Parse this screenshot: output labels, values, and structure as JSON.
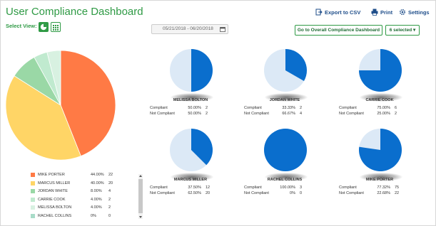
{
  "header": {
    "title": "User Compliance Dashboard",
    "export_label": "Export to CSV",
    "print_label": "Print",
    "settings_label": "Settings"
  },
  "toolbar": {
    "select_view_label": "Select View:",
    "date_range": "05/21/2018 - 06/20/2018",
    "overall_button": "Go to Overall Compliance Dashboard",
    "selected_dropdown": "6 selected ▾"
  },
  "colors": {
    "accent_green": "#2f9a45",
    "compliant_blue": "#0a6ecd",
    "not_compliant_light": "#dce9f6"
  },
  "main_pie": {
    "slices": [
      {
        "name": "MIKE PORTER",
        "percent": "44.00%",
        "count": "22",
        "value": 44,
        "color": "#ff7a45"
      },
      {
        "name": "MARCUS MILLER",
        "percent": "40.00%",
        "count": "20",
        "value": 40,
        "color": "#ffd566"
      },
      {
        "name": "JORDAN WHITE",
        "percent": "8.00%",
        "count": "4",
        "value": 8,
        "color": "#9ad8a6"
      },
      {
        "name": "CARRIE COOK",
        "percent": "4.00%",
        "count": "2",
        "value": 4,
        "color": "#c0eacf"
      },
      {
        "name": "MELISSA BOLTON",
        "percent": "4.00%",
        "count": "2",
        "value": 4,
        "color": "#d8f1e1"
      },
      {
        "name": "RACHEL COLLINS",
        "percent": "0%",
        "count": "0",
        "value": 0,
        "color": "#a9dcc9"
      }
    ]
  },
  "users": [
    {
      "name": "MELISSA BOLTON",
      "compliant_pct": "50.00%",
      "compliant_cnt": "2",
      "not_pct": "50.00%",
      "not_cnt": "2",
      "compliant_fraction": 0.5
    },
    {
      "name": "JORDAN WHITE",
      "compliant_pct": "33.33%",
      "compliant_cnt": "2",
      "not_pct": "66.67%",
      "not_cnt": "4",
      "compliant_fraction": 0.3333
    },
    {
      "name": "CARRIE COOK",
      "compliant_pct": "75.00%",
      "compliant_cnt": "6",
      "not_pct": "25.00%",
      "not_cnt": "2",
      "compliant_fraction": 0.75
    },
    {
      "name": "MARCUS MILLER",
      "compliant_pct": "37.50%",
      "compliant_cnt": "12",
      "not_pct": "62.50%",
      "not_cnt": "20",
      "compliant_fraction": 0.375
    },
    {
      "name": "RACHEL COLLINS",
      "compliant_pct": "100.00%",
      "compliant_cnt": "3",
      "not_pct": "0%",
      "not_cnt": "0",
      "compliant_fraction": 1.0
    },
    {
      "name": "MIKE PORTER",
      "compliant_pct": "77.32%",
      "compliant_cnt": "75",
      "not_pct": "22.68%",
      "not_cnt": "22",
      "compliant_fraction": 0.7732
    }
  ],
  "labels": {
    "compliant": "Compliant",
    "not_compliant": "Not Compliant"
  }
}
